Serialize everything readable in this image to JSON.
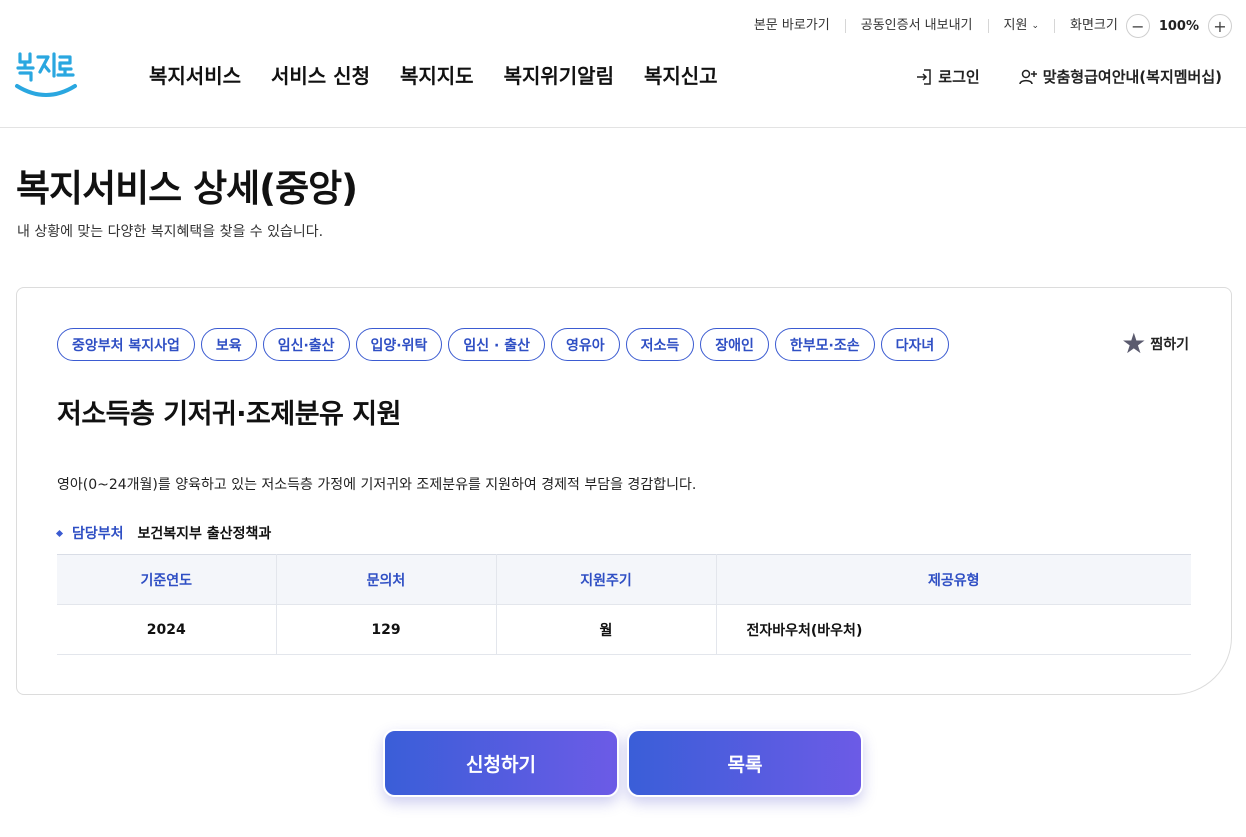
{
  "utility": {
    "skip_link": "본문 바로가기",
    "cert_export": "공동인증서 내보내기",
    "support": "지원",
    "screen_size": "화면크기",
    "zoom_level": "100%",
    "zoom_out": "−",
    "zoom_in": "+"
  },
  "logo": {
    "text": "복지로"
  },
  "gnb": [
    "복지서비스",
    "서비스 신청",
    "복지지도",
    "복지위기알림",
    "복지신고"
  ],
  "header_right": {
    "login": "로그인",
    "membership": "맞춤형급여안내(복지멤버십)"
  },
  "page": {
    "title": "복지서비스 상세(중앙)",
    "subtitle": "내 상황에 맞는 다양한 복지혜택을 찾을 수 있습니다."
  },
  "card": {
    "tags": [
      "중앙부처 복지사업",
      "보육",
      "임신·출산",
      "입양·위탁",
      "임신 · 출산",
      "영유아",
      "저소득",
      "장애인",
      "한부모·조손",
      "다자녀"
    ],
    "favorite_label": "찜하기",
    "service_title": "저소득층 기저귀·조제분유 지원",
    "description": "영아(0~24개월)를 양육하고 있는 저소득층 가정에 기저귀와 조제분유를 지원하여 경제적 부담을 경감합니다.",
    "dept_label": "담당부처",
    "dept_value": "보건복지부 출산정책과",
    "table": {
      "headers": [
        "기준연도",
        "문의처",
        "지원주기",
        "제공유형"
      ],
      "row": [
        "2024",
        "129",
        "월",
        "전자바우처(바우처)"
      ]
    }
  },
  "buttons": {
    "apply": "신청하기",
    "list": "목록"
  },
  "colors": {
    "accent": "#3b5bd1",
    "button_gradient_start": "#3a5ed8",
    "button_gradient_end": "#6c5be6",
    "logo_blue": "#2aa7e0"
  }
}
